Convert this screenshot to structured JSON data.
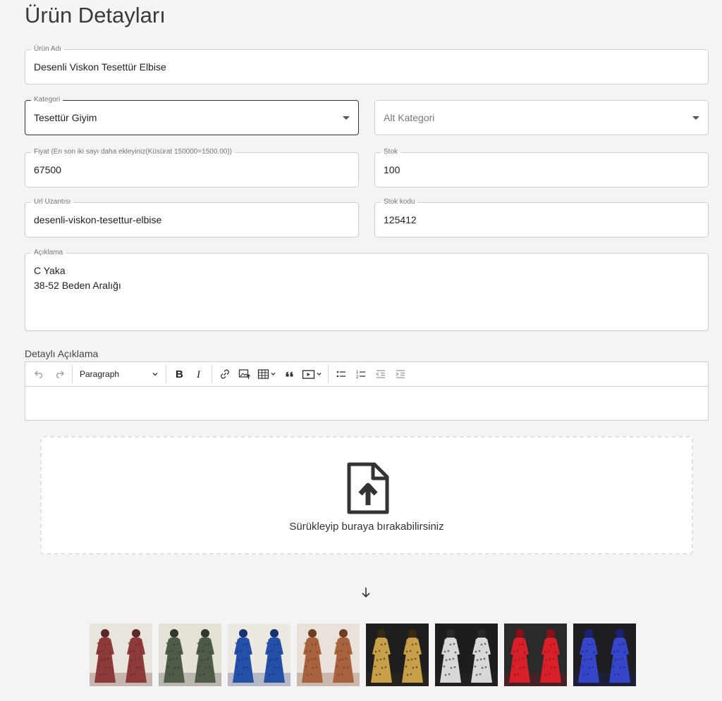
{
  "page": {
    "title": "Ürün Detayları"
  },
  "form": {
    "product_name": {
      "label": "Ürün Adı",
      "value": "Desenli Viskon Tesettür Elbise"
    },
    "category": {
      "label": "Kategori",
      "value": "Tesettür Giyim"
    },
    "subcategory": {
      "placeholder": "Alt Kategori"
    },
    "price": {
      "label": "Fiyat (En son iki sayı daha ekleyiniz(Küsürat 150000=1500.00))",
      "value": "67500"
    },
    "stock": {
      "label": "Stok",
      "value": "100"
    },
    "url_slug": {
      "label": "Url Uzantısı",
      "value": "desenli-viskon-tesettur-elbise"
    },
    "stock_code": {
      "label": "Stok kodu",
      "value": "125412"
    },
    "description": {
      "label": "Açıklama",
      "value": "C Yaka\n38-52 Beden Aralığı"
    }
  },
  "editor": {
    "label": "Detaylı Açıklama",
    "heading_select": "Paragraph",
    "tools": [
      "undo-icon",
      "redo-icon",
      "bold-icon",
      "italic-icon",
      "link-icon",
      "insert-image-icon",
      "table-icon",
      "blockquote-icon",
      "media-embed-icon",
      "bulleted-list-icon",
      "numbered-list-icon",
      "outdent-icon",
      "indent-icon"
    ]
  },
  "dropzone": {
    "text": "Sürükleyip buraya bırakabilirsiniz",
    "icon": "file-upload-icon"
  },
  "thumbnails": [
    {
      "colors": [
        "#e9e4dc",
        "#8c3a3a",
        "#5a2a2a"
      ]
    },
    {
      "colors": [
        "#e7e2d8",
        "#4e5a4a",
        "#2f382e"
      ]
    },
    {
      "colors": [
        "#ece8e2",
        "#2450a8",
        "#163170"
      ]
    },
    {
      "colors": [
        "#e8e2da",
        "#a8623e",
        "#6e3d24"
      ]
    },
    {
      "colors": [
        "#1e1e1e",
        "#c9a04a",
        "#3a2a14"
      ]
    },
    {
      "colors": [
        "#1d1d1d",
        "#d8d8d8",
        "#2a2a2a"
      ]
    },
    {
      "colors": [
        "#2a2a2a",
        "#d8202a",
        "#8e1016"
      ]
    },
    {
      "colors": [
        "#1e1e22",
        "#3646c8",
        "#1c2276"
      ]
    }
  ]
}
